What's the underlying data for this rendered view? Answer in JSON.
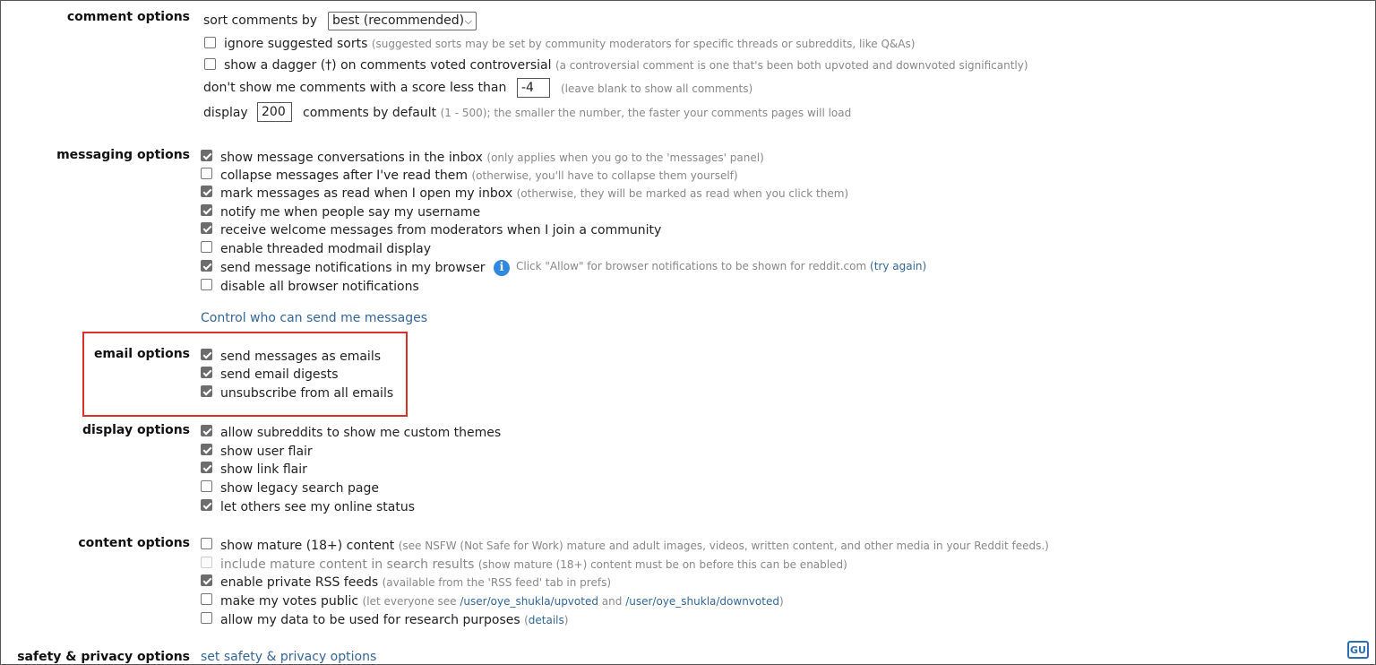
{
  "comment_options": {
    "title": "comment options",
    "sort_label": "sort comments by",
    "sort_value": "best (recommended)",
    "ignore_suggested": {
      "label": "ignore suggested sorts",
      "note": "(suggested sorts may be set by community moderators for specific threads or subreddits, like Q&As)",
      "checked": false
    },
    "dagger": {
      "label": "show a dagger (†) on comments voted controversial",
      "note": "(a controversial comment is one that's been both upvoted and downvoted significantly)",
      "checked": false
    },
    "score_label": "don't show me comments with a score less than",
    "score_value": "-4",
    "score_note": "(leave blank to show all comments)",
    "display_label": "display",
    "display_value": "200",
    "display_suffix": "comments by default",
    "display_note": "(1 - 500); the smaller the number, the faster your comments pages will load"
  },
  "messaging_options": {
    "title": "messaging options",
    "items": [
      {
        "label": "show message conversations in the inbox",
        "note": "(only applies when you go to the 'messages' panel)",
        "checked": true
      },
      {
        "label": "collapse messages after I've read them",
        "note": "(otherwise, you'll have to collapse them yourself)",
        "checked": false
      },
      {
        "label": "mark messages as read when I open my inbox",
        "note": "(otherwise, they will be marked as read when you click them)",
        "checked": true
      },
      {
        "label": "notify me when people say my username",
        "note": "",
        "checked": true
      },
      {
        "label": "receive welcome messages from moderators when I join a community",
        "note": "",
        "checked": true
      },
      {
        "label": "enable threaded modmail display",
        "note": "",
        "checked": false
      },
      {
        "label": "send message notifications in my browser",
        "note": "",
        "checked": true
      },
      {
        "label": "disable all browser notifications",
        "note": "",
        "checked": false
      }
    ],
    "browser_hint": "Click \"Allow\" for browser notifications to be shown for reddit.com",
    "try_again": "(try again)",
    "control_link": "Control who can send me messages"
  },
  "email_options": {
    "title": "email options",
    "items": [
      {
        "label": "send messages as emails",
        "checked": true
      },
      {
        "label": "send email digests",
        "checked": true
      },
      {
        "label": "unsubscribe from all emails",
        "checked": true
      }
    ]
  },
  "display_options": {
    "title": "display options",
    "items": [
      {
        "label": "allow subreddits to show me custom themes",
        "checked": true
      },
      {
        "label": "show user flair",
        "checked": true
      },
      {
        "label": "show link flair",
        "checked": true
      },
      {
        "label": "show legacy search page",
        "checked": false
      },
      {
        "label": "let others see my online status",
        "checked": true
      }
    ]
  },
  "content_options": {
    "title": "content options",
    "items": [
      {
        "label": "show mature (18+) content",
        "note": "(see NSFW (Not Safe for Work) mature and adult images, videos, written content, and other media in your Reddit feeds.)",
        "checked": false
      },
      {
        "label": "include mature content in search results",
        "note": "(show mature (18+) content must be on before this can be enabled)",
        "checked": false,
        "disabled": true
      },
      {
        "label": "enable private RSS feeds",
        "note": "(available from the 'RSS feed' tab in prefs)",
        "checked": true
      },
      {
        "label": "make my votes public",
        "checked": false
      },
      {
        "label": "allow my data to be used for research purposes",
        "checked": false
      }
    ],
    "votes_note_a": "(let everyone see",
    "votes_link_up": "/user/oye_shukla/upvoted",
    "votes_and": "and",
    "votes_link_down": "/user/oye_shukla/downvoted",
    "votes_close": ")",
    "research_open": "(",
    "research_link": "details",
    "research_close": ")"
  },
  "safety_options": {
    "title": "safety & privacy options",
    "link": "set safety & privacy options"
  },
  "watermark": "GU"
}
